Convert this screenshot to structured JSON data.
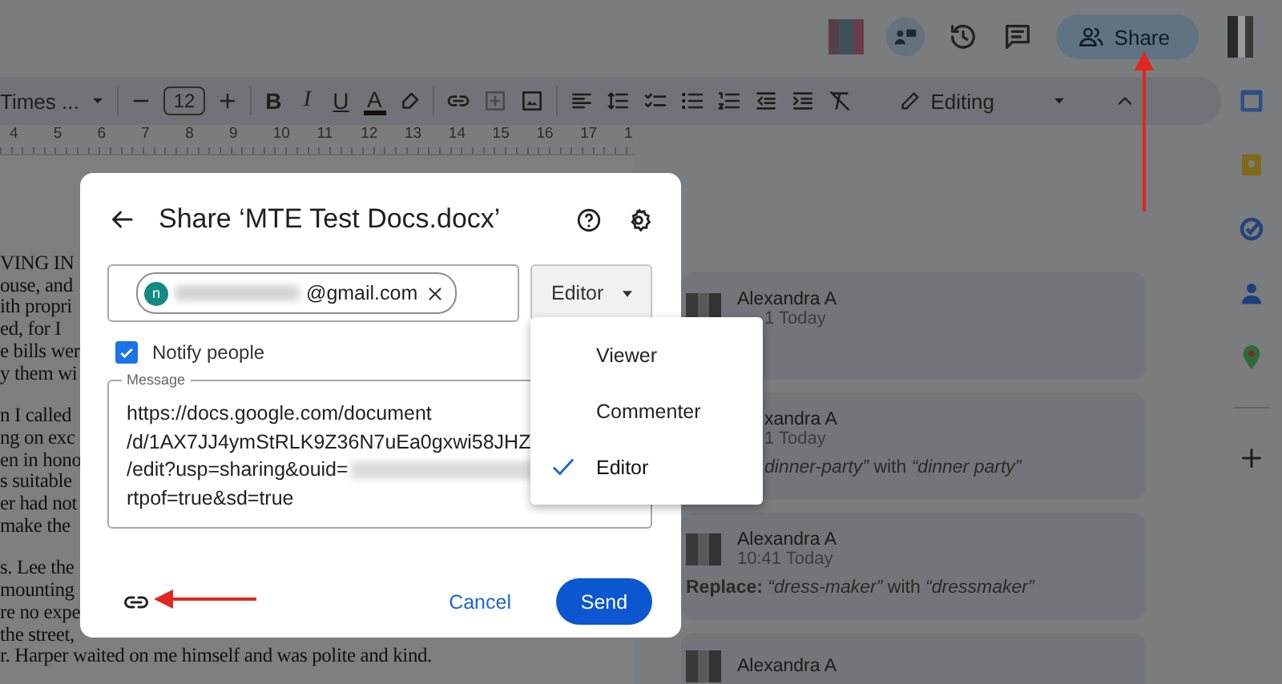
{
  "top_bar": {
    "share_button": {
      "label": "Share"
    }
  },
  "toolbar": {
    "font": "Times ...",
    "font_size": "12",
    "bold": "B",
    "italic": "I",
    "underline": "U",
    "text_color": "A",
    "mode": "Editing"
  },
  "ruler": {
    "marks": [
      "4",
      "5",
      "6",
      "7",
      "8",
      "9",
      "10",
      "11",
      "12",
      "13",
      "14",
      "15",
      "16",
      "17",
      "1"
    ]
  },
  "document": {
    "paragraphs": [
      [
        "VING IN",
        "ouse, and",
        "ith propri",
        "ed, for I",
        "e bills wer",
        "y them wi"
      ],
      [
        "n I called",
        "ng on exc",
        "en in hono",
        "s suitable",
        "er had not",
        "make the"
      ],
      [
        "s. Lee the",
        "mounting",
        "re no expe",
        "the street,",
        "r. Harper waited on me himself and was polite and kind."
      ]
    ]
  },
  "comments": [
    {
      "author": "Alexandra A",
      "time": "1 Today"
    },
    {
      "author": "xandra A",
      "time": "1 Today",
      "body": "*dinner-party”* with *“dinner party”*"
    },
    {
      "author": "Alexandra A",
      "time": "10:41 Today",
      "body": "**Replace:** *“dress-maker”* with *“dressmaker”*"
    },
    {
      "author": "Alexandra A"
    }
  ],
  "dialog": {
    "title": "Share ‘MTE Test Docs.docx’",
    "recipient": {
      "initial": "n",
      "email": "@gmail.com"
    },
    "role": "Editor",
    "notify": {
      "label": "Notify people",
      "checked": true
    },
    "message": {
      "label": "Message",
      "lines": [
        "https://docs.google.com/document",
        "/d/1AX7JJ4ymStRLK9Z36N7uEa0gxwi58JHZ",
        "/edit?usp=sharing&ouid=",
        "rtpof=true&sd=true"
      ]
    },
    "cancel": "Cancel",
    "send": "Send"
  },
  "role_menu": [
    {
      "label": "Viewer",
      "selected": false
    },
    {
      "label": "Commenter",
      "selected": false
    },
    {
      "label": "Editor",
      "selected": true
    }
  ]
}
